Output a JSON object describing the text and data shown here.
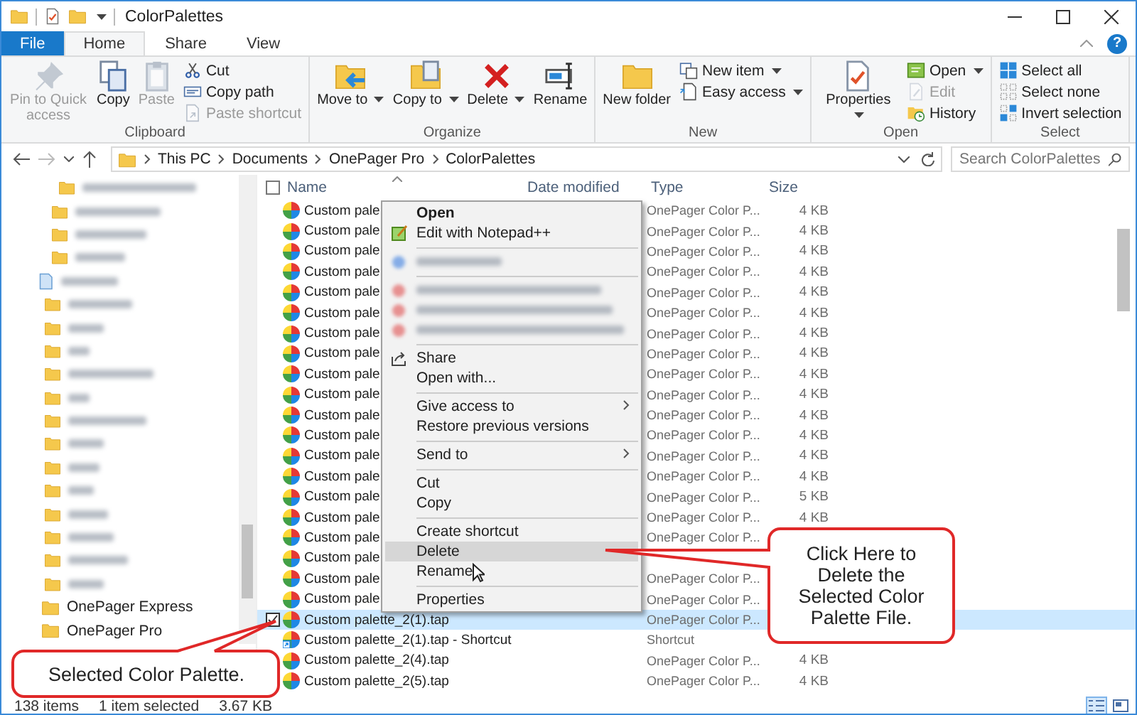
{
  "window": {
    "title": "ColorPalettes"
  },
  "help_button": {
    "label": "?"
  },
  "ribbon_tabs": [
    {
      "label": "File",
      "kind": "file",
      "selected": false
    },
    {
      "label": "Home",
      "kind": "tab",
      "selected": true
    },
    {
      "label": "Share",
      "kind": "tab",
      "selected": false
    },
    {
      "label": "View",
      "kind": "tab",
      "selected": false
    }
  ],
  "ribbon_groups": [
    {
      "label": "Clipboard",
      "buttons": [
        {
          "label": "Pin to Quick access",
          "kind": "large",
          "disabled": true,
          "dropdown": false
        },
        {
          "label": "Copy",
          "kind": "large",
          "disabled": false,
          "dropdown": false
        },
        {
          "label": "Paste",
          "kind": "large",
          "disabled": true,
          "dropdown": false
        },
        {
          "label": "Cut",
          "kind": "small",
          "disabled": false,
          "dropdown": false
        },
        {
          "label": "Copy path",
          "kind": "small",
          "disabled": false,
          "dropdown": false
        },
        {
          "label": "Paste shortcut",
          "kind": "small",
          "disabled": true,
          "dropdown": false
        }
      ]
    },
    {
      "label": "Organize",
      "buttons": [
        {
          "label": "Move to",
          "kind": "large",
          "disabled": false,
          "dropdown": true
        },
        {
          "label": "Copy to",
          "kind": "large",
          "disabled": false,
          "dropdown": true
        },
        {
          "label": "Delete",
          "kind": "large",
          "disabled": false,
          "dropdown": true
        },
        {
          "label": "Rename",
          "kind": "large",
          "disabled": false,
          "dropdown": false
        }
      ]
    },
    {
      "label": "New",
      "buttons": [
        {
          "label": "New folder",
          "kind": "large",
          "disabled": false,
          "dropdown": false
        },
        {
          "label": "New item",
          "kind": "small",
          "disabled": false,
          "dropdown": true
        },
        {
          "label": "Easy access",
          "kind": "small",
          "disabled": false,
          "dropdown": true
        }
      ]
    },
    {
      "label": "Open",
      "buttons": [
        {
          "label": "Properties",
          "kind": "large",
          "disabled": false,
          "dropdown": true
        },
        {
          "label": "Open",
          "kind": "small",
          "disabled": false,
          "dropdown": true
        },
        {
          "label": "Edit",
          "kind": "small",
          "disabled": true,
          "dropdown": false
        },
        {
          "label": "History",
          "kind": "small",
          "disabled": false,
          "dropdown": false
        }
      ]
    },
    {
      "label": "Select",
      "buttons": [
        {
          "label": "Select all",
          "kind": "small",
          "disabled": false,
          "dropdown": false
        },
        {
          "label": "Select none",
          "kind": "small",
          "disabled": false,
          "dropdown": false
        },
        {
          "label": "Invert selection",
          "kind": "small",
          "disabled": false,
          "dropdown": false
        }
      ]
    }
  ],
  "address": {
    "path": [
      "This PC",
      "Documents",
      "OnePager Pro",
      "ColorPalettes"
    ]
  },
  "search": {
    "placeholder": "Search ColorPalettes"
  },
  "sidebar": {
    "items": [
      {
        "label": "OnePager Express"
      },
      {
        "label": "OnePager Pro"
      }
    ]
  },
  "columns": [
    "Name",
    "Date modified",
    "Type",
    "Size"
  ],
  "select_all": {
    "checked": false
  },
  "rows": [
    {
      "name": "Custom pale",
      "type": "OnePager Color P...",
      "size": "4 KB",
      "kind": "file",
      "selected": false
    },
    {
      "name": "Custom pale",
      "type": "OnePager Color P...",
      "size": "4 KB",
      "kind": "file",
      "selected": false
    },
    {
      "name": "Custom pale",
      "type": "OnePager Color P...",
      "size": "4 KB",
      "kind": "file",
      "selected": false
    },
    {
      "name": "Custom pale",
      "type": "OnePager Color P...",
      "size": "4 KB",
      "kind": "file",
      "selected": false
    },
    {
      "name": "Custom pale",
      "type": "OnePager Color P...",
      "size": "4 KB",
      "kind": "file",
      "selected": false
    },
    {
      "name": "Custom pale",
      "type": "OnePager Color P...",
      "size": "4 KB",
      "kind": "file",
      "selected": false
    },
    {
      "name": "Custom pale",
      "type": "OnePager Color P...",
      "size": "4 KB",
      "kind": "file",
      "selected": false
    },
    {
      "name": "Custom pale",
      "type": "OnePager Color P...",
      "size": "4 KB",
      "kind": "file",
      "selected": false
    },
    {
      "name": "Custom pale",
      "type": "OnePager Color P...",
      "size": "4 KB",
      "kind": "file",
      "selected": false
    },
    {
      "name": "Custom pale",
      "type": "OnePager Color P...",
      "size": "4 KB",
      "kind": "file",
      "selected": false
    },
    {
      "name": "Custom pale",
      "type": "OnePager Color P...",
      "size": "4 KB",
      "kind": "file",
      "selected": false
    },
    {
      "name": "Custom pale",
      "type": "OnePager Color P...",
      "size": "4 KB",
      "kind": "file",
      "selected": false
    },
    {
      "name": "Custom pale",
      "type": "OnePager Color P...",
      "size": "4 KB",
      "kind": "file",
      "selected": false
    },
    {
      "name": "Custom pale",
      "type": "OnePager Color P...",
      "size": "4 KB",
      "kind": "file",
      "selected": false
    },
    {
      "name": "Custom pale",
      "type": "OnePager Color P...",
      "size": "5 KB",
      "kind": "file",
      "selected": false
    },
    {
      "name": "Custom pale",
      "type": "OnePager Color P...",
      "size": "4 KB",
      "kind": "file",
      "selected": false
    },
    {
      "name": "Custom pale",
      "type": "OnePager Color P...",
      "kind": "file",
      "selected": false
    },
    {
      "name": "Custom pale",
      "kind": "file",
      "selected": false
    },
    {
      "name": "Custom pale",
      "type": "OnePager Color P...",
      "kind": "file",
      "selected": false
    },
    {
      "name": "Custom pale",
      "type": "OnePager Color P...",
      "kind": "file",
      "selected": false
    },
    {
      "name": "Custom palette_2(1).tap",
      "type": "OnePager Color P...",
      "kind": "file",
      "selected": true
    },
    {
      "name": "Custom palette_2(1).tap - Shortcut",
      "type": "Shortcut",
      "kind": "shortcut",
      "selected": false
    },
    {
      "name": "Custom palette_2(4).tap",
      "type": "OnePager Color P...",
      "size": "4 KB",
      "kind": "file",
      "selected": false
    },
    {
      "name": "Custom palette_2(5).tap",
      "type": "OnePager Color P...",
      "size": "4 KB",
      "kind": "file",
      "selected": false
    }
  ],
  "context_menu": {
    "items": [
      {
        "kind": "default",
        "label": "Open",
        "selected": false
      },
      {
        "kind": "item",
        "label": "Edit with Notepad++",
        "selected": false
      },
      {
        "kind": "separator"
      },
      {
        "kind": "blurred"
      },
      {
        "kind": "separator"
      },
      {
        "kind": "blurred"
      },
      {
        "kind": "blurred"
      },
      {
        "kind": "blurred"
      },
      {
        "kind": "separator"
      },
      {
        "kind": "item",
        "label": "Share",
        "selected": false
      },
      {
        "kind": "item",
        "label": "Open with...",
        "selected": false
      },
      {
        "kind": "separator"
      },
      {
        "kind": "submenu",
        "label": "Give access to",
        "selected": false
      },
      {
        "kind": "item",
        "label": "Restore previous versions",
        "selected": false
      },
      {
        "kind": "separator"
      },
      {
        "kind": "submenu",
        "label": "Send to",
        "selected": false
      },
      {
        "kind": "separator"
      },
      {
        "kind": "item",
        "label": "Cut",
        "selected": false
      },
      {
        "kind": "item",
        "label": "Copy",
        "selected": false
      },
      {
        "kind": "separator"
      },
      {
        "kind": "item",
        "label": "Create shortcut",
        "selected": false
      },
      {
        "kind": "item",
        "label": "Delete",
        "selected": true
      },
      {
        "kind": "item",
        "label": "Rename",
        "selected": false
      },
      {
        "kind": "separator"
      },
      {
        "kind": "item",
        "label": "Properties",
        "selected": false
      }
    ]
  },
  "callouts": [
    {
      "kind": "menu",
      "text": "Click Here to Delete the Selected Color Palette File."
    },
    {
      "kind": "row",
      "text": "Selected Color Palette."
    }
  ],
  "status_bar": {
    "item_count": "138 items",
    "selection": "1 item selected",
    "selection_size": "3.67 KB"
  },
  "view_modes": [
    {
      "kind": "details",
      "selected": true
    },
    {
      "kind": "large_icons",
      "selected": false
    }
  ]
}
